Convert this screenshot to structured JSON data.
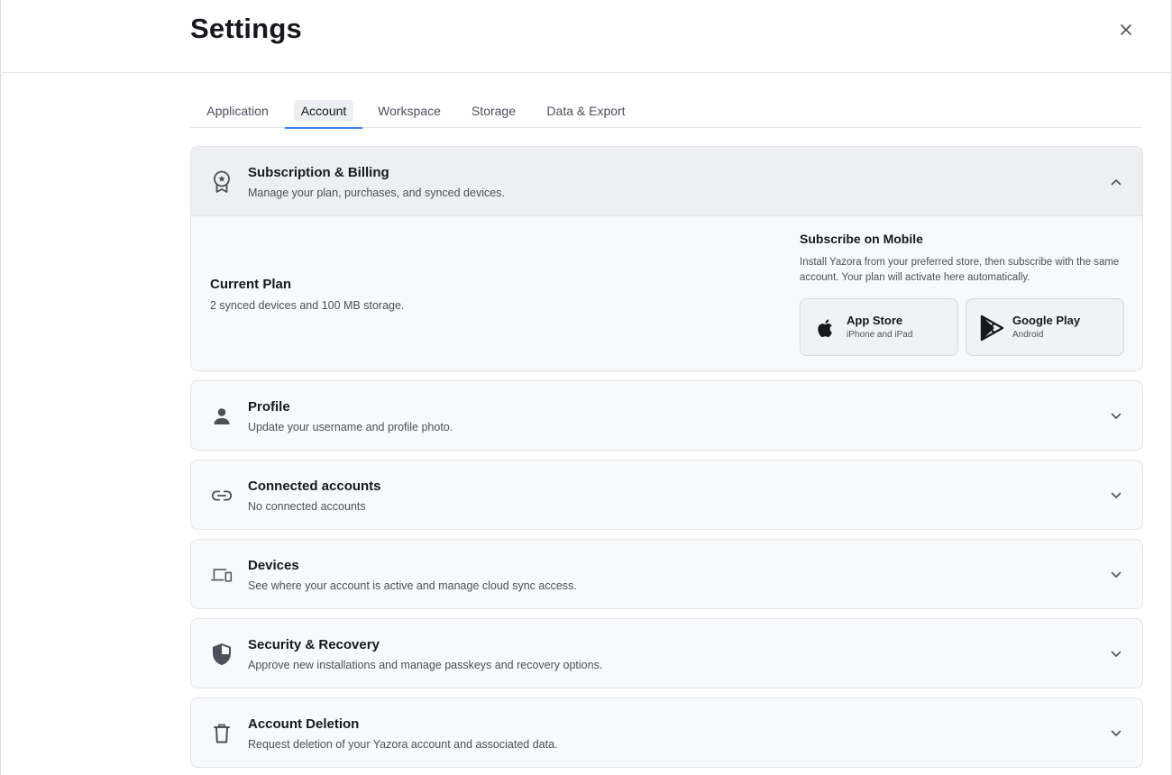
{
  "header": {
    "title": "Settings",
    "close_icon": "close-icon"
  },
  "tabs": [
    {
      "label": "Application",
      "active": false
    },
    {
      "label": "Account",
      "active": true
    },
    {
      "label": "Workspace",
      "active": false
    },
    {
      "label": "Storage",
      "active": false
    },
    {
      "label": "Data & Export",
      "active": false
    }
  ],
  "colors": {
    "accent": "#3b82f6",
    "card_bg": "#f8f9fb",
    "card_expanded_header": "#eeeff2",
    "border": "#e3e5e8"
  },
  "sections": {
    "subscription": {
      "title": "Subscription & Billing",
      "description": "Manage your plan, purchases, and synced devices.",
      "icon": "award-badge-icon",
      "expanded": true,
      "current_plan": {
        "title": "Current Plan",
        "description": "2 synced devices and 100 MB storage."
      },
      "mobile": {
        "title": "Subscribe on Mobile",
        "description": "Install Yazora from your preferred store, then subscribe with the same account. Your plan will activate here automatically.",
        "app_store": {
          "name": "App Store",
          "sub": "iPhone and iPad",
          "icon": "apple-icon"
        },
        "google_play": {
          "name": "Google Play",
          "sub": "Android",
          "icon": "google-play-icon"
        }
      }
    },
    "profile": {
      "title": "Profile",
      "description": "Update your username and profile photo.",
      "icon": "person-icon",
      "expanded": false
    },
    "connected": {
      "title": "Connected accounts",
      "description": "No connected accounts",
      "icon": "link-icon",
      "expanded": false
    },
    "devices": {
      "title": "Devices",
      "description": "See where your account is active and manage cloud sync access.",
      "icon": "devices-icon",
      "expanded": false
    },
    "security": {
      "title": "Security & Recovery",
      "description": "Approve new installations and manage passkeys and recovery options.",
      "icon": "shield-icon",
      "expanded": false
    },
    "deletion": {
      "title": "Account Deletion",
      "description": "Request deletion of your Yazora account and associated data.",
      "icon": "trash-icon",
      "expanded": false
    }
  }
}
